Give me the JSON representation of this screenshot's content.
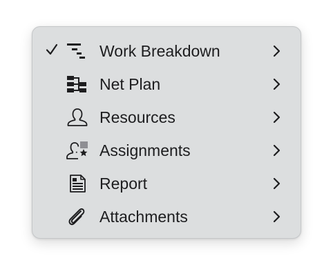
{
  "menu": {
    "items": [
      {
        "label": "Work Breakdown",
        "icon": "work-breakdown-icon",
        "checked": true,
        "has_submenu": true
      },
      {
        "label": "Net Plan",
        "icon": "net-plan-icon",
        "checked": false,
        "has_submenu": true
      },
      {
        "label": "Resources",
        "icon": "person-icon",
        "checked": false,
        "has_submenu": true
      },
      {
        "label": "Assignments",
        "icon": "person-star-icon",
        "checked": false,
        "has_submenu": true
      },
      {
        "label": "Report",
        "icon": "document-icon",
        "checked": false,
        "has_submenu": true
      },
      {
        "label": "Attachments",
        "icon": "paperclip-icon",
        "checked": false,
        "has_submenu": true
      }
    ]
  },
  "colors": {
    "menu_background": "#dcdedf",
    "text": "#1d1d1f",
    "icon": "#1d1d1f"
  }
}
